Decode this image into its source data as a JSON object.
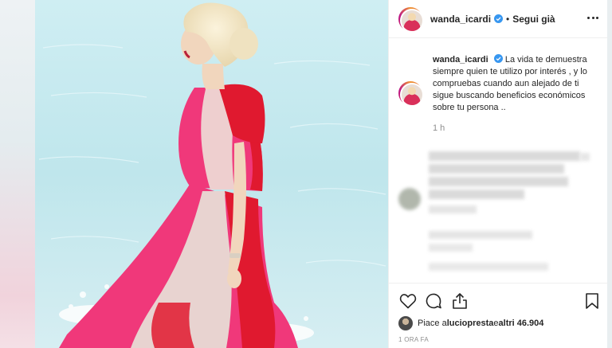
{
  "post": {
    "username": "wanda_icardi",
    "follow_label": "Segui già",
    "dot": "•",
    "caption_username": "wanda_icardi",
    "caption": "La vida te demuestra siempre quien te utilizo por interés , y lo compruebas cuando aun alejado de ti sigue buscando beneficios económicos sobre tu persona ..",
    "caption_time": "1 h",
    "likes_prefix": "Piace a ",
    "likes_user": "luciopresta",
    "likes_middle": " e ",
    "likes_count": "altri 46.904",
    "date": "1 ORA FA"
  },
  "icons": {
    "more": "more-options-icon",
    "verified": "verified-badge-icon",
    "like": "heart-icon",
    "comment": "comment-icon",
    "share": "share-icon",
    "save": "bookmark-icon"
  },
  "colors": {
    "verified": "#3897f0",
    "text": "#262626",
    "muted": "#8e8e8e",
    "border": "#efefef",
    "dress_red": "#e0192f",
    "dress_pink": "#f0387a"
  }
}
